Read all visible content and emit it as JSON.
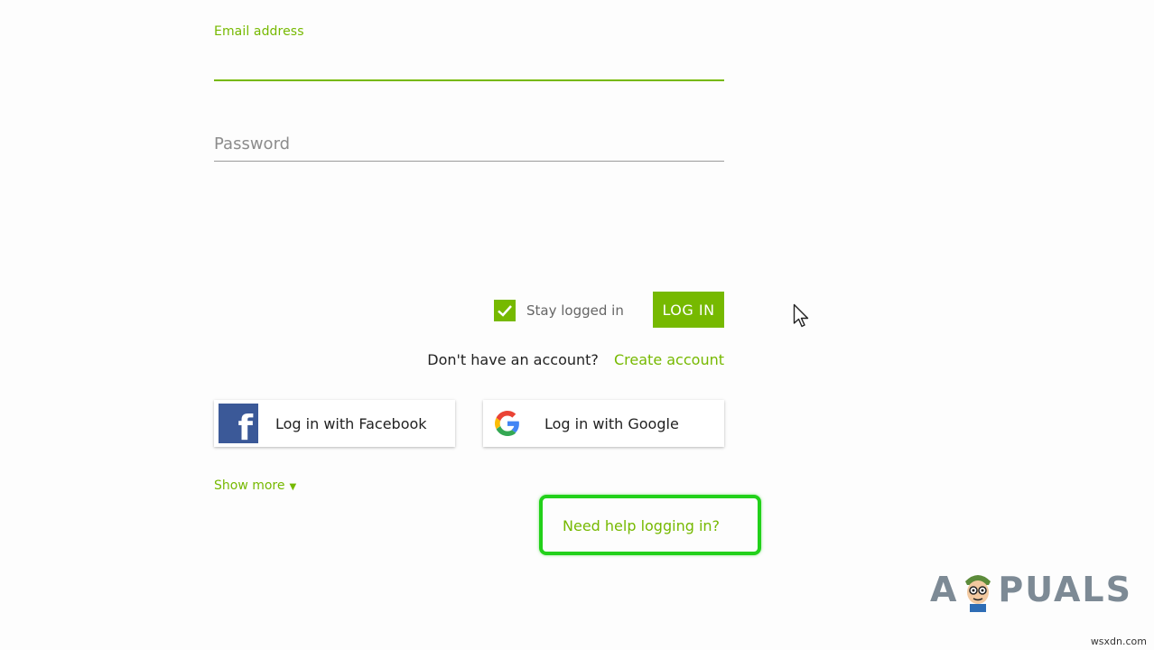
{
  "form": {
    "email_label": "Email address",
    "email_value": "",
    "password_placeholder": "Password",
    "stay_logged_in_label": "Stay logged in",
    "stay_logged_in_checked": true,
    "login_button_label": "LOG IN",
    "no_account_text": "Don't have an account?",
    "create_account_label": "Create account",
    "facebook_button_label": "Log in with Facebook",
    "google_button_label": "Log in with Google",
    "show_more_label": "Show more",
    "help_link_label": "Need help logging in?"
  },
  "icons": {
    "facebook": "facebook-icon",
    "google": "google-icon",
    "check": "checkmark-icon",
    "caret": "caret-down-icon",
    "cursor": "mouse-pointer-icon"
  },
  "colors": {
    "accent": "#76b900",
    "facebook_blue": "#3b5998",
    "highlight_box": "#22d11a"
  },
  "watermark": {
    "logo_left": "A",
    "logo_right": "PUALS",
    "site": "wsxdn.com"
  }
}
